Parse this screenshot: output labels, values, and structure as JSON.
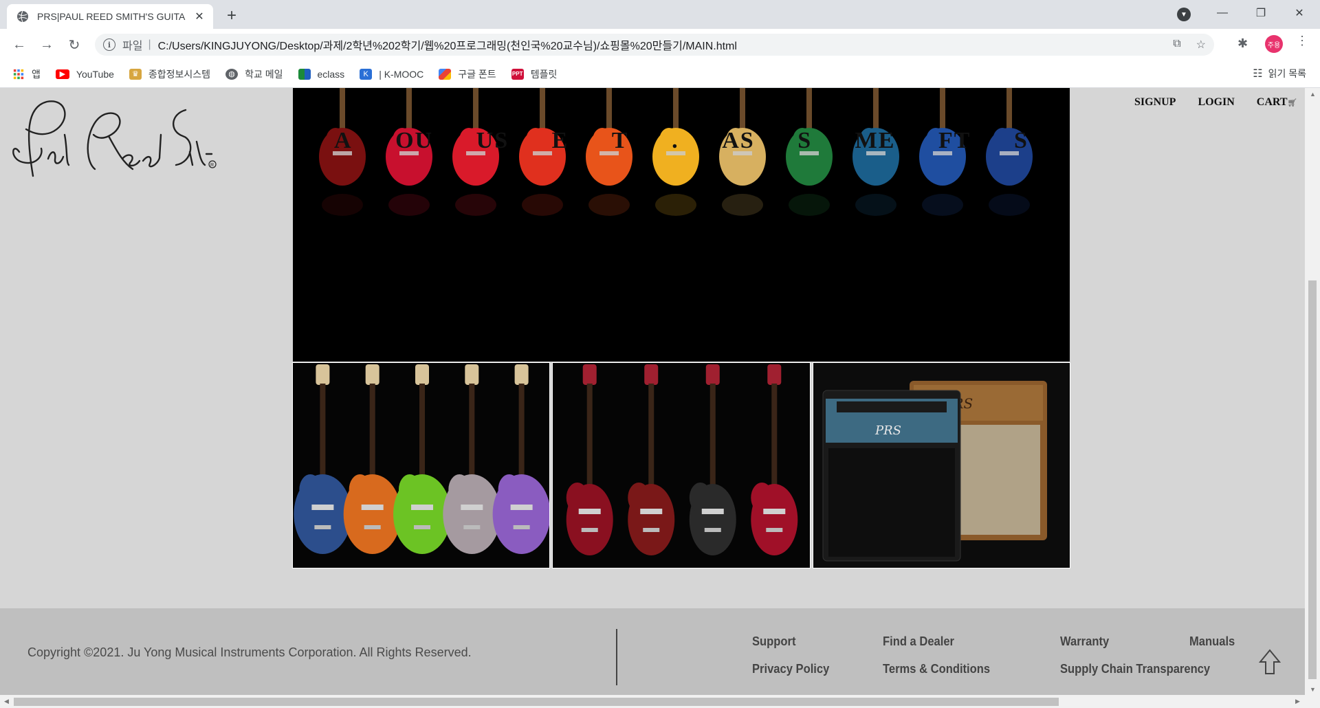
{
  "browser": {
    "tab_title": "PRS|PAUL REED SMITH'S GUITA",
    "new_tab_label": "+",
    "omnibox": {
      "scheme_label": "파일",
      "separator": "|",
      "url": "C:/Users/KINGJUYONG/Desktop/과제/2학년%202학기/웹%20프로그래밍(천인국%20교수님)/쇼핑몰%20만들기/MAIN.html"
    },
    "profile_initials": "주용",
    "bookmarks": [
      {
        "label": "앱",
        "icon": "apps-grid-icon"
      },
      {
        "label": "YouTube",
        "icon": "youtube-icon"
      },
      {
        "label": "종합정보시스템",
        "icon": "school-crest-icon"
      },
      {
        "label": "학교 메일",
        "icon": "globe-icon"
      },
      {
        "label": "eclass",
        "icon": "eclass-icon"
      },
      {
        "label": "| K-MOOC",
        "icon": "kmooc-icon"
      },
      {
        "label": "구글 폰트",
        "icon": "google-fonts-icon"
      },
      {
        "label": "템플릿",
        "icon": "ppt-icon"
      }
    ],
    "reading_list_label": "읽기 목록"
  },
  "site": {
    "nav": {
      "signup": "SIGNUP",
      "login": "LOGIN",
      "cart": "CART"
    },
    "hero_overlay_letters": [
      "A",
      "OU",
      "US",
      "E",
      "T",
      ".",
      "AS",
      "S",
      "ME",
      "FT",
      "S"
    ],
    "guitar_colors": [
      "#7a1010",
      "#c8102e",
      "#d91a2a",
      "#e0301e",
      "#e8541a",
      "#f0b020",
      "#d7b060",
      "#1f7a3a",
      "#1a5e8a",
      "#1f4ea0",
      "#1c3f8a"
    ],
    "tiles": [
      {
        "name": "guitars",
        "colors": [
          "#2c4e8c",
          "#d86a1e",
          "#6cc324",
          "#a59aa0",
          "#8a5cc0"
        ]
      },
      {
        "name": "basses",
        "colors": [
          "#8a1020",
          "#7a1818",
          "#2a2a2a",
          "#a01028"
        ]
      },
      {
        "name": "amps"
      }
    ],
    "footer": {
      "copyright": "Copyright ©2021. Ju Yong Musical Instruments Corporation. All Rights Reserved.",
      "links": {
        "support": "Support",
        "find_dealer": "Find a Dealer",
        "warranty": "Warranty",
        "manuals": "Manuals",
        "privacy": "Privacy Policy",
        "terms": "Terms & Conditions",
        "supply_chain": "Supply Chain Transparency"
      }
    }
  }
}
